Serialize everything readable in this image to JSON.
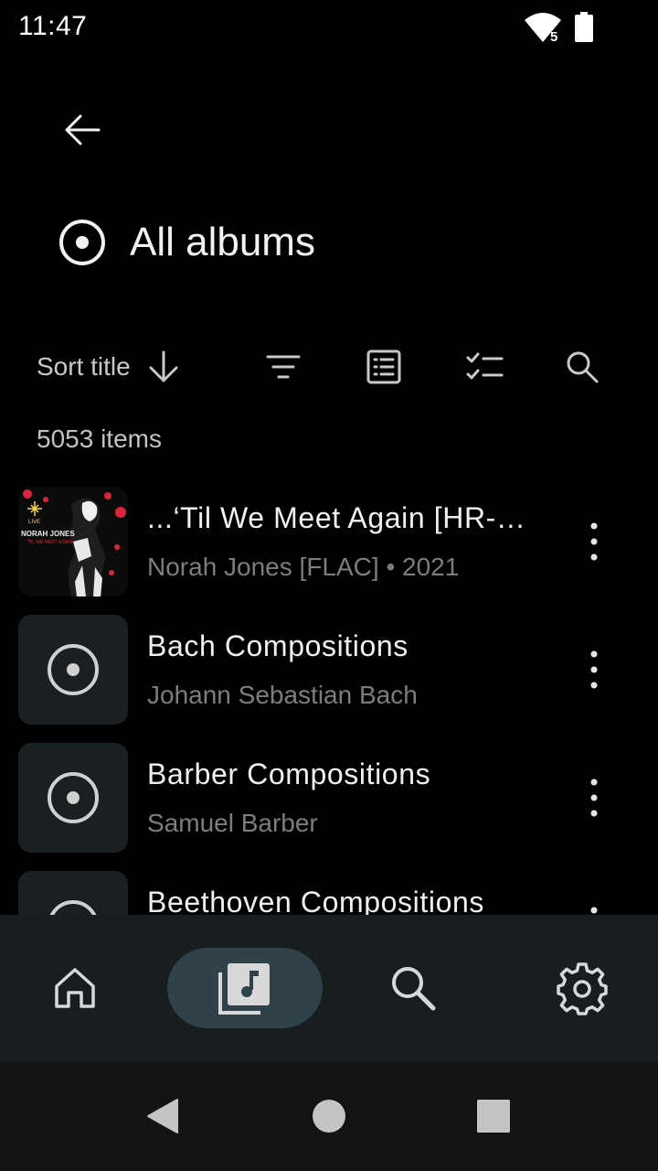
{
  "status_bar": {
    "time": "11:47",
    "wifi_badge": "5",
    "icons": [
      "wifi-icon",
      "battery-icon"
    ]
  },
  "header": {
    "back_icon": "arrow-back-icon",
    "icon": "album-icon",
    "title": "All albums"
  },
  "toolbar": {
    "sort_label": "Sort title",
    "sort_icon": "arrow-down-icon",
    "icons": [
      "filter-icon",
      "list-view-icon",
      "select-icon",
      "search-icon"
    ]
  },
  "item_count": "5053 items",
  "albums": [
    {
      "title": "...‘Til We Meet Again [HR-…",
      "subtitle": "Norah Jones [FLAC] • 2021",
      "has_art": true
    },
    {
      "title": "Bach Compositions",
      "subtitle": "Johann Sebastian Bach",
      "has_art": false
    },
    {
      "title": "Barber Compositions",
      "subtitle": "Samuel Barber",
      "has_art": false
    },
    {
      "title": "Beethoven Compositions",
      "subtitle": "",
      "has_art": false
    }
  ],
  "album_art": {
    "line1": "NORAH JONES",
    "line2": "'TIL WE MEET AGAIN",
    "live": "LIVE"
  },
  "bottom_nav": {
    "items": [
      "home-icon",
      "library-icon",
      "search-icon",
      "settings-icon"
    ],
    "active": "library-icon"
  },
  "system_nav": [
    "back-triangle-icon",
    "home-circle-icon",
    "recents-square-icon"
  ],
  "colors": {
    "background": "#000000",
    "nav_background": "#181d20",
    "active_pill": "#2f4149",
    "thumb_background": "#1a1f22",
    "secondary_text": "#7d7d7d"
  }
}
